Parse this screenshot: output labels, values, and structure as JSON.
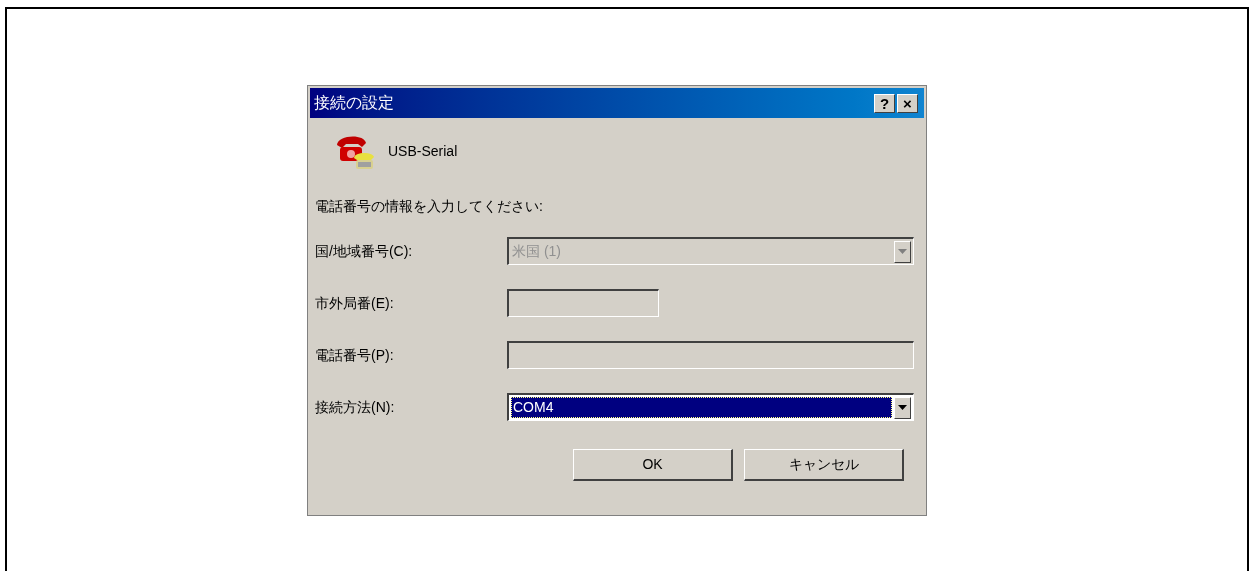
{
  "window": {
    "title": "接続の設定",
    "title_buttons": [
      "?",
      "×"
    ]
  },
  "device": {
    "name": "USB-Serial"
  },
  "prompt": "電話番号の情報を入力してください:",
  "fields": [
    {
      "kind": "combo",
      "label": "国/地域番号(C):",
      "value": "米国 (1)",
      "disabled": true,
      "focused": false,
      "wide": true
    },
    {
      "kind": "text",
      "label": "市外局番(E):",
      "disabled": true,
      "wide": false
    },
    {
      "kind": "text",
      "label": "電話番号(P):",
      "disabled": true,
      "wide": true
    },
    {
      "kind": "combo",
      "label": "接続方法(N):",
      "value": "COM4",
      "disabled": false,
      "focused": true,
      "wide": true
    }
  ],
  "buttons": [
    "OK",
    "キャンセル"
  ]
}
